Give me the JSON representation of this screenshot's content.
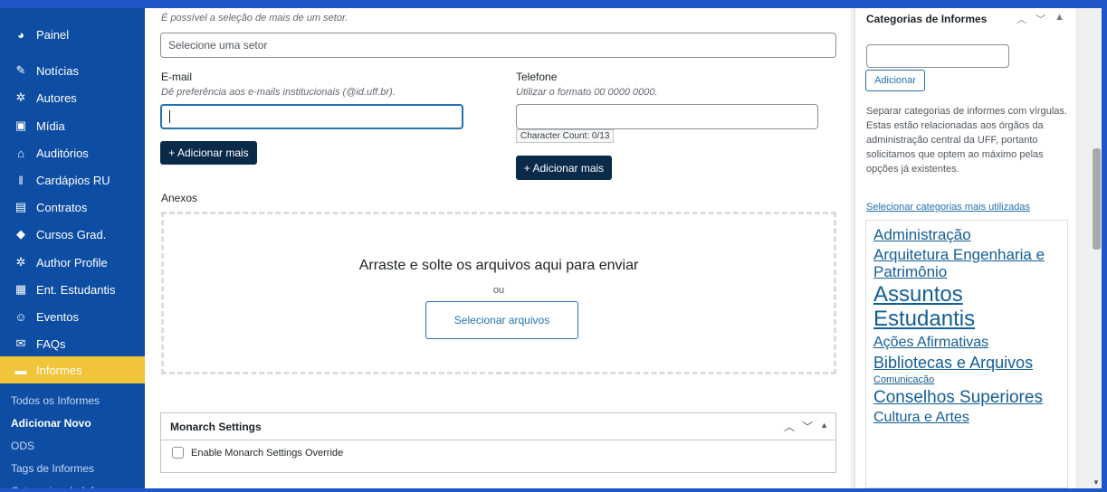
{
  "sidebar": {
    "items": [
      {
        "label": "Painel",
        "icon": "dashboard-icon"
      },
      {
        "label": "Notícias",
        "icon": "pin-icon"
      },
      {
        "label": "Autores",
        "icon": "groups-icon"
      },
      {
        "label": "Mídia",
        "icon": "media-icon"
      },
      {
        "label": "Auditórios",
        "icon": "building-icon"
      },
      {
        "label": "Cardápios RU",
        "icon": "food-icon"
      },
      {
        "label": "Contratos",
        "icon": "document-icon"
      },
      {
        "label": "Cursos Grad.",
        "icon": "graduation-cap-icon"
      },
      {
        "label": "Author Profile",
        "icon": "groups-icon"
      },
      {
        "label": "Ent. Estudantis",
        "icon": "id-icon"
      },
      {
        "label": "Eventos",
        "icon": "smiley-icon"
      },
      {
        "label": "FAQs",
        "icon": "chat-icon"
      },
      {
        "label": "Informes",
        "icon": "note-icon"
      }
    ],
    "active_item": "Informes",
    "submenu": [
      "Todos os Informes",
      "Adicionar Novo",
      "ODS",
      "Tags de Informes",
      "Categorias de Informes"
    ],
    "submenu_current": "Adicionar Novo"
  },
  "form": {
    "sector_hint": "É possível a seleção de mais de um setor.",
    "sector_placeholder": "Selecione uma setor",
    "email_label": "E-mail",
    "email_hint": "Dê preferência aos e-mails institucionais (@id.uff.br).",
    "email_value": "",
    "phone_label": "Telefone",
    "phone_hint": "Utilizar o formato 00 0000 0000.",
    "phone_value": "",
    "char_count": "Character Count: 0/13",
    "add_more_label": "+ Adicionar mais",
    "attachments_label": "Anexos",
    "drop_text": "Arraste e solte os arquivos aqui para enviar",
    "drop_or": "ou",
    "select_files_label": "Selecionar arquivos"
  },
  "monarch": {
    "title": "Monarch Settings",
    "checkbox_label": "Enable Monarch Settings Override",
    "checked": false
  },
  "categories": {
    "title": "Categorias de Informes",
    "add_label": "Adicionar",
    "note": "Separar categorias de informes com vírgulas. Estas estão relacionadas aos órgãos da administração central da UFF, portanto solicitamos que optem ao máximo pelas opções já existentes.",
    "most_used_link": "Selecionar categorias mais utilizadas",
    "tags": [
      {
        "label": "Administração",
        "size": 17
      },
      {
        "label": "Arquitetura Engenharia e Patrimônio",
        "size": 17
      },
      {
        "label": "Assuntos Estudantis",
        "size": 24
      },
      {
        "label": "Ações Afirmativas",
        "size": 16
      },
      {
        "label": "Bibliotecas e Arquivos",
        "size": 18
      },
      {
        "label": "Comunicação",
        "size": 11
      },
      {
        "label": "Conselhos Superiores",
        "size": 19
      },
      {
        "label": "Cultura e Artes",
        "size": 16
      }
    ]
  },
  "colors": {
    "frame": "#1e56c8",
    "sidebar_bg": "#0d4da3",
    "active_item": "#f0c53a",
    "dark_button": "#0a2a4a",
    "link": "#2271b1"
  }
}
